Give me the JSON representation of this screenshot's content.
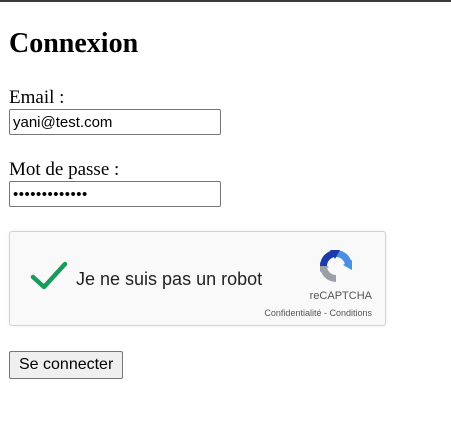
{
  "page": {
    "title": "Connexion"
  },
  "form": {
    "email_label": "Email :",
    "email_value": "yani@test.com",
    "password_label": "Mot de passe :",
    "password_value": "•••••••••••••",
    "submit_label": "Se connecter"
  },
  "captcha": {
    "checked": true,
    "label": "Je ne suis pas un robot",
    "brand": "reCAPTCHA",
    "privacy_link": "Confidentialité",
    "separator": " - ",
    "terms_link": "Conditions",
    "check_color": "#1a9b5e"
  }
}
